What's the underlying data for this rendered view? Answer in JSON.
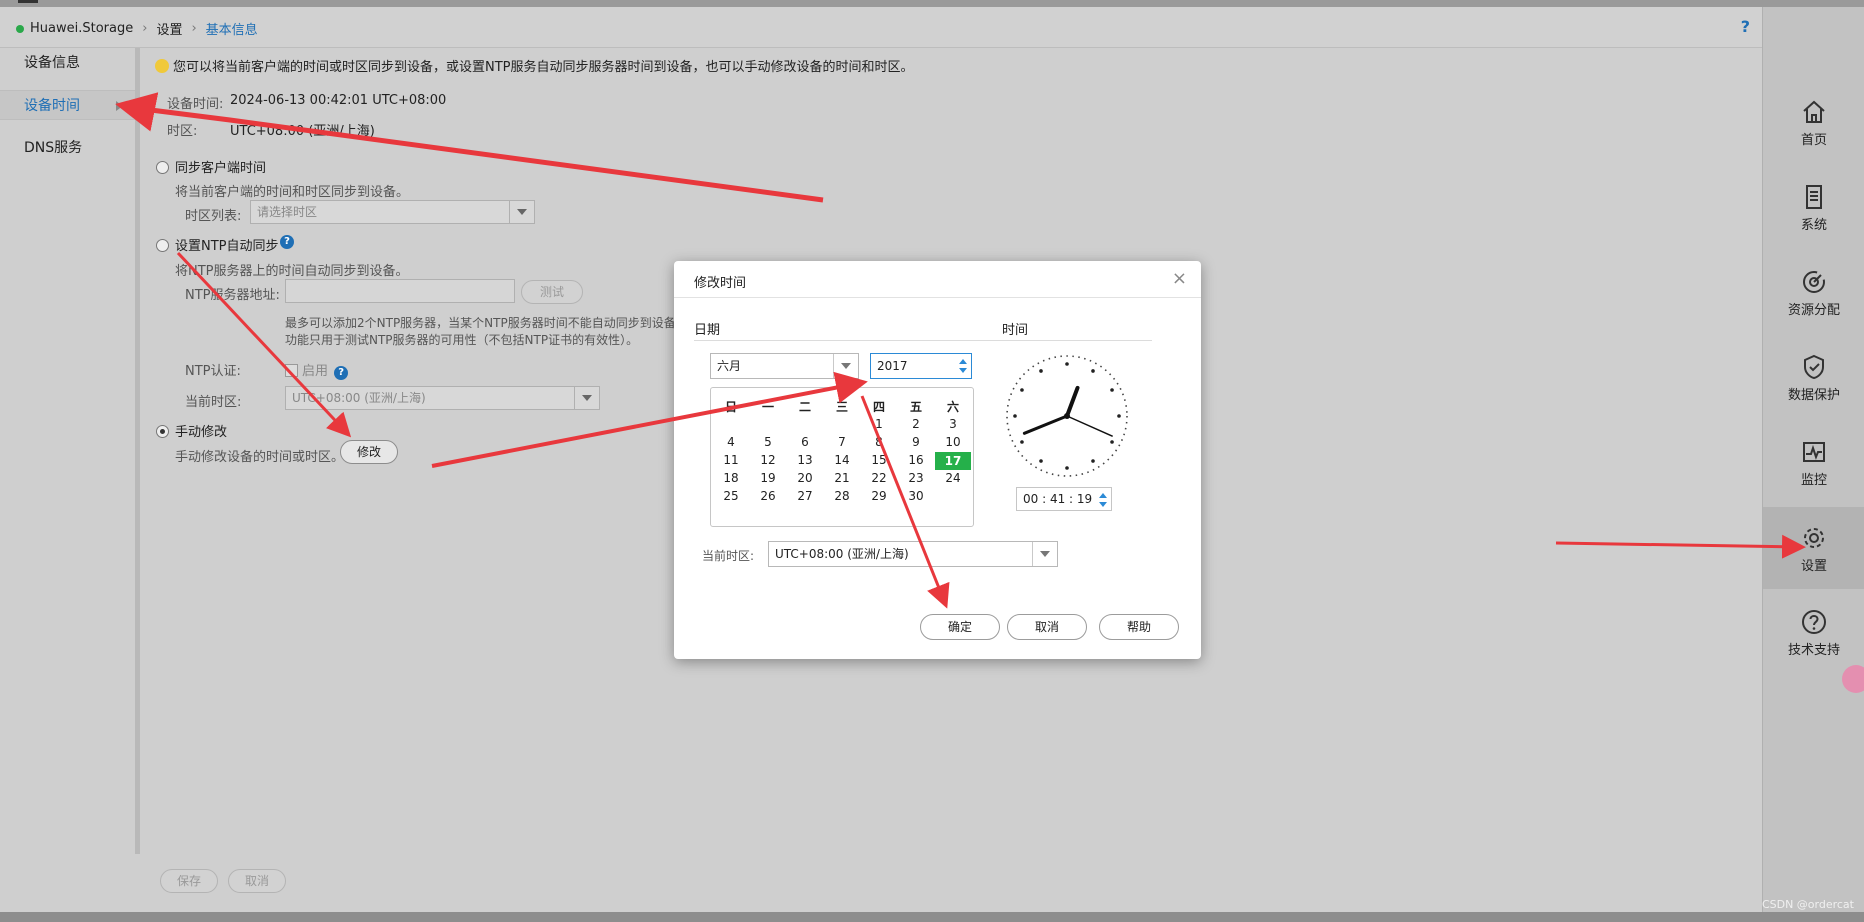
{
  "header": {
    "breadcrumb": [
      "Huawei.Storage",
      "设置",
      "基本信息"
    ],
    "help": "?"
  },
  "leftnav": {
    "items": [
      "设备信息",
      "设备时间",
      "DNS服务"
    ],
    "active_index": 1
  },
  "main": {
    "tip": "您可以将当前客户端的时间或时区同步到设备，或设置NTP服务自动同步服务器时间到设备，也可以手动修改设备的时间和时区。",
    "device_time_label": "设备时间:",
    "device_time_value": "2024-06-13 00:42:01 UTC+08:00",
    "timezone_label": "时区:",
    "timezone_value": "UTC+08:00 (亚洲/上海)",
    "sync_client": {
      "label": "同步客户端时间",
      "desc": "将当前客户端的时间和时区同步到设备。",
      "tz_list_label": "时区列表:",
      "tz_placeholder": "请选择时区"
    },
    "ntp": {
      "label": "设置NTP自动同步",
      "desc": "将NTP服务器上的时间自动同步到设备。",
      "server_label": "NTP服务器地址:",
      "test_button": "测试",
      "note_line1": "最多可以添加2个NTP服务器，当某个NTP服务器时间不能自动同步到设备",
      "note_line2": "功能只用于测试NTP服务器的可用性（不包括NTP证书的有效性）。",
      "auth_label": "NTP认证:",
      "enable_label": "启用",
      "current_tz_label": "当前时区:",
      "current_tz_value": "UTC+08:00 (亚洲/上海)"
    },
    "manual": {
      "label": "手动修改",
      "desc": "手动修改设备的时间或时区。",
      "modify_button": "修改"
    },
    "save_button": "保存",
    "cancel_button": "取消"
  },
  "rightbar": {
    "items": [
      {
        "label": "首页",
        "icon": "home-icon"
      },
      {
        "label": "系统",
        "icon": "document-icon"
      },
      {
        "label": "资源分配",
        "icon": "resource-icon"
      },
      {
        "label": "数据保护",
        "icon": "shield-icon"
      },
      {
        "label": "监控",
        "icon": "monitor-icon"
      },
      {
        "label": "设置",
        "icon": "gear-icon"
      },
      {
        "label": "技术支持",
        "icon": "question-icon"
      }
    ],
    "active_index": 5
  },
  "dialog": {
    "title": "修改时间",
    "close": "×",
    "date_label": "日期",
    "time_label": "时间",
    "month_value": "六月",
    "year_value": "2017",
    "weekdays": [
      "日",
      "一",
      "二",
      "三",
      "四",
      "五",
      "六"
    ],
    "weeks": [
      [
        "",
        "",
        "",
        "",
        "1",
        "2",
        "3"
      ],
      [
        "4",
        "5",
        "6",
        "7",
        "8",
        "9",
        "10"
      ],
      [
        "11",
        "12",
        "13",
        "14",
        "15",
        "16",
        "17"
      ],
      [
        "18",
        "19",
        "20",
        "21",
        "22",
        "23",
        "24"
      ],
      [
        "25",
        "26",
        "27",
        "28",
        "29",
        "30",
        ""
      ]
    ],
    "selected_day": "17",
    "time_value": "00 : 41 : 19",
    "clock": {
      "hour": 0,
      "minute": 41,
      "second": 19
    },
    "tz_label": "当前时区:",
    "tz_value": "UTC+08:00 (亚洲/上海)",
    "ok_button": "确定",
    "cancel_button": "取消",
    "help_button": "帮助"
  },
  "watermark": "CSDN @ordercat",
  "colors": {
    "accent": "#1f6fb5",
    "selected_day": "#25b04a",
    "annotation_arrow": "#e8383d"
  }
}
